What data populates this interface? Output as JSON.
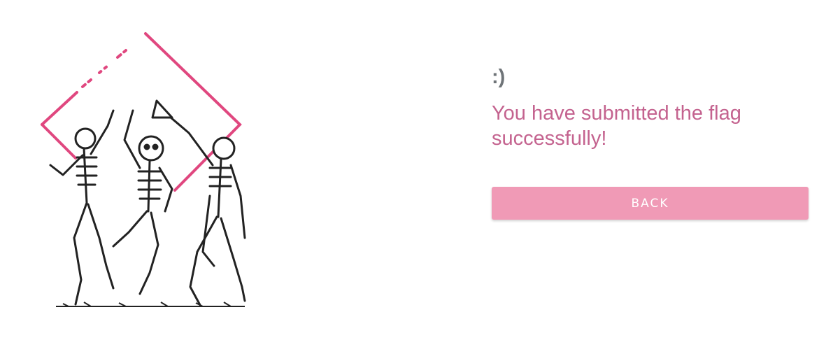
{
  "illustration": {
    "icon": "dancing-skeletons-illustration",
    "frame_color": "#e0477f"
  },
  "result": {
    "emoticon": ":)",
    "message": "You have submitted the flag successfully!"
  },
  "actions": {
    "back_label": "BACK"
  },
  "colors": {
    "message": "#c4638f",
    "emoticon": "#6f7478",
    "button_bg": "#f09ab6",
    "button_text": "#ffffff"
  }
}
